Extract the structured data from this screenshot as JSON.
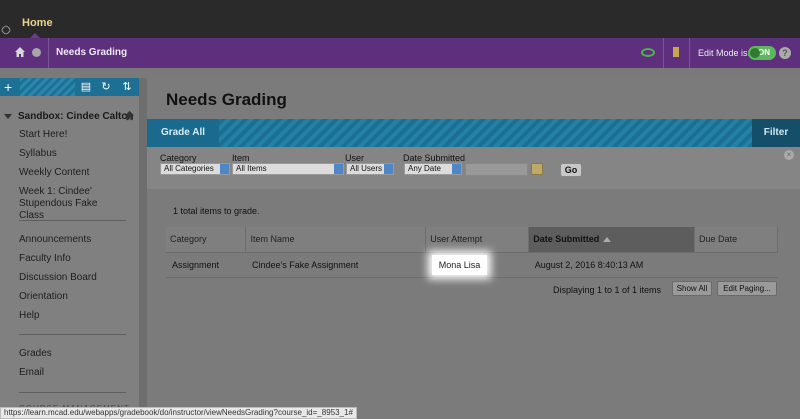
{
  "topbar": {
    "home_tab": "Home"
  },
  "breadcrumb": {
    "title": "Needs Grading"
  },
  "edit_mode": {
    "label": "Edit Mode is:",
    "state": "ON"
  },
  "help": {
    "label": "?"
  },
  "course_menu": {
    "course_title": "Sandbox: Cindee Calton",
    "group1": [
      "Start Here!",
      "Syllabus",
      "Weekly Content",
      "Week 1: Cindee' Stupendous Fake Class"
    ],
    "group2": [
      "Announcements",
      "Faculty Info",
      "Discussion Board",
      "Orientation",
      "Help"
    ],
    "group3": [
      "Grades",
      "Email"
    ],
    "section_label": "COURSE MANAGEMENT"
  },
  "page": {
    "title": "Needs Grading",
    "grade_all": "Grade All",
    "filter": "Filter"
  },
  "filters": {
    "category_label": "Category",
    "category_value": "All Categories",
    "item_label": "Item",
    "item_value": "All Items",
    "user_label": "User",
    "user_value": "All Users",
    "date_label": "Date Submitted",
    "date_value": "Any Date",
    "go": "Go"
  },
  "results": {
    "total_text": "1 total items to grade.",
    "columns": [
      "Category",
      "Item Name",
      "User Attempt",
      "Date Submitted",
      "Due Date"
    ],
    "rows": [
      {
        "category": "Assignment",
        "item": "Cindee's Fake Assignment",
        "user": "Mona Lisa",
        "date": "August 2, 2016 8:40:13 AM",
        "due": ""
      }
    ],
    "pager_text": "Displaying 1 to 1 of 1 items",
    "show_all": "Show All",
    "edit_paging": "Edit Paging..."
  },
  "status_url": "https://learn.mcad.edu/webapps/gradebook/do/instructor/viewNeedsGrading?course_id=_8953_1#"
}
